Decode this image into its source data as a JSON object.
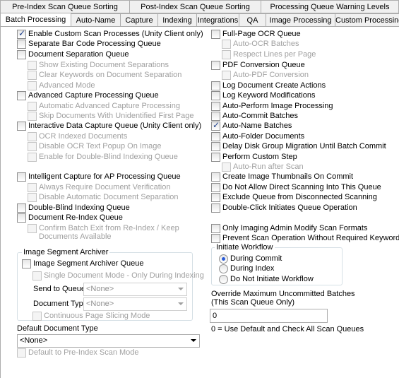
{
  "tabs_row1": [
    "Pre-Index Scan Queue Sorting",
    "Post-Index Scan Queue Sorting",
    "Processing Queue Warning Levels"
  ],
  "tabs_row2": [
    "Batch Processing",
    "Auto-Name",
    "Capture",
    "Indexing",
    "Integrations",
    "QA",
    "Image Processing",
    "Custom Processing"
  ],
  "left": {
    "enable_custom_scan": "Enable Custom Scan Processes (Unity Client only)",
    "separate_barcode": "Separate Bar Code Processing Queue",
    "doc_separation": "Document Separation Queue",
    "show_existing_separations": "Show Existing Document Separations",
    "clear_keywords": "Clear Keywords on Document Separation",
    "advanced_mode": "Advanced Mode",
    "advanced_capture": "Advanced Capture Processing Queue",
    "auto_advanced_capture": "Automatic Advanced Capture Processing",
    "skip_unidentified": "Skip Documents With Unidentified First Page",
    "interactive_capture": "Interactive Data Capture Queue (Unity Client only)",
    "ocr_indexed": "OCR Indexed Documents",
    "disable_ocr_popup": "Disable OCR Text Popup On Image",
    "double_blind_enable": "Enable for Double-Blind Indexing Queue",
    "intelligent_capture": "Intelligent Capture for AP Processing Queue",
    "always_verify": "Always Require Document Verification",
    "disable_auto_separation": "Disable Automatic Document Separation",
    "double_blind_queue": "Double-Blind Indexing Queue",
    "reindex_queue": "Document Re-Index Queue",
    "confirm_exit_1": "Confirm Batch Exit from Re-Index / Keep",
    "confirm_exit_2": "Documents Available",
    "isa_legend": "Image Segment Archiver",
    "isa_queue": "Image Segment Archiver Queue",
    "single_doc_mode": "Single Document Mode - Only During Indexing",
    "send_to_queue_label": "Send to Queue",
    "send_to_queue_value": "<None>",
    "doc_type_label": "Document Type",
    "doc_type_value": "<None>",
    "continuous_slicing": "Continuous Page Slicing Mode",
    "default_doc_type_label": "Default Document Type",
    "default_doc_type_value": "<None>",
    "default_pre_index": "Default to Pre-Index Scan Mode"
  },
  "right": {
    "fullpage_ocr": "Full-Page OCR Queue",
    "auto_ocr_batches": "Auto-OCR Batches",
    "respect_lines": "Respect Lines per Page",
    "pdf_conversion": "PDF Conversion Queue",
    "auto_pdf": "Auto-PDF Conversion",
    "log_create": "Log Document Create Actions",
    "log_keyword": "Log Keyword Modifications",
    "auto_image_processing": "Auto-Perform Image Processing",
    "auto_commit": "Auto-Commit Batches",
    "auto_name": "Auto-Name Batches",
    "auto_folder": "Auto-Folder Documents",
    "delay_migration": "Delay Disk Group Migration Until Batch Commit",
    "custom_step": "Perform Custom Step",
    "auto_run_after_scan": "Auto-Run after Scan",
    "thumbnails": "Create Image Thumbnails On Commit",
    "no_direct_scan": "Do Not Allow Direct Scanning Into This Queue",
    "exclude_disconnected": "Exclude Queue from Disconnected Scanning",
    "double_click_initiates": "Double-Click Initiates Queue Operation",
    "only_admin_formats": "Only Imaging Admin Modify Scan Formats",
    "prevent_scan_keywords": "Prevent Scan Operation Without Required Keywords",
    "workflow_legend": "Initiate Workflow",
    "during_commit": "During Commit",
    "during_index": "During Index",
    "do_not_initiate": "Do Not Initiate Workflow",
    "override_label_1": "Override Maximum Uncommitted Batches",
    "override_label_2": "(This Scan Queue Only)",
    "override_value": "0",
    "override_hint": "0 = Use Default and Check All Scan Queues"
  }
}
